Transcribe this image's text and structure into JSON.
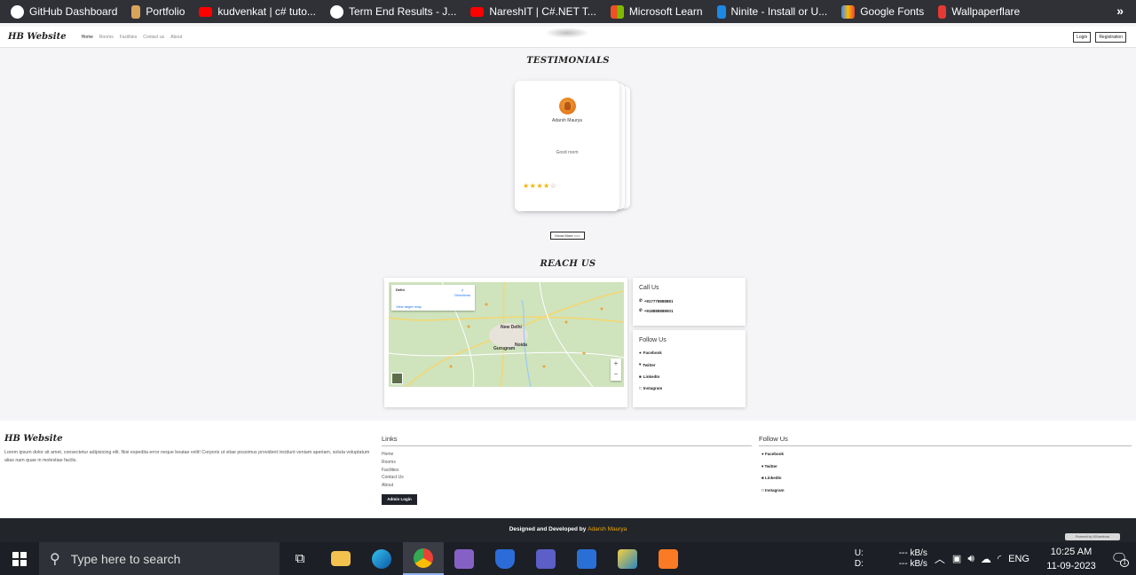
{
  "bookmarks": {
    "items": [
      {
        "label": "GitHub Dashboard",
        "icon": "github-icon",
        "color": "#ffffff"
      },
      {
        "label": "Portfolio",
        "icon": "person-icon",
        "color": "#d9a45a"
      },
      {
        "label": "kudvenkat | c# tuto...",
        "icon": "youtube-icon",
        "color": "#ff0000"
      },
      {
        "label": "Term End Results - J...",
        "icon": "globe-icon",
        "color": "#ffffff"
      },
      {
        "label": "NareshIT | C#.NET T...",
        "icon": "youtube-icon",
        "color": "#ff0000"
      },
      {
        "label": "Microsoft Learn",
        "icon": "microsoft-icon",
        "color": "#f25022"
      },
      {
        "label": "Ninite - Install or U...",
        "icon": "ninite-icon",
        "color": "#1e88e5"
      },
      {
        "label": "Google Fonts",
        "icon": "google-fonts-icon",
        "color": "#4285f4"
      },
      {
        "label": "Wallpaperflare",
        "icon": "wallpaperflare-icon",
        "color": "#e53935"
      }
    ],
    "more": "»"
  },
  "navbar": {
    "brand": "HB Website",
    "links": [
      "Home",
      "Rooms",
      "Facilities",
      "Contact us",
      "About"
    ],
    "login": "Login",
    "register": "Registration"
  },
  "testimonials": {
    "title": "TESTIMONIALS",
    "name": "Adarsh Maurya",
    "review": "Good room",
    "rating": 4,
    "stars_filled": "★★★★",
    "stars_empty": "☆",
    "know_more": "Know More >>>"
  },
  "reach_us": {
    "title": "REACH US",
    "map": {
      "place": "Delhi",
      "larger_map": "View larger map",
      "directions": "Directions",
      "zoom_in": "+",
      "zoom_out": "−",
      "cities": [
        "New Delhi",
        "Gurugram",
        "Noida"
      ]
    },
    "call_us": {
      "title": "Call Us",
      "phones": [
        "+917778888881",
        "+918888888001"
      ]
    },
    "follow_us": {
      "title": "Follow Us",
      "links": [
        "Facebook",
        "Twitter",
        "LinkedIn",
        "Instagram"
      ]
    }
  },
  "footer": {
    "brand": "HB Website",
    "description": "Lorem ipsum dolor sit amet, consectetur adipisicing elit. Nisi expedita error neque beatae velit! Corporis ut vitae possimus provident incidunt veniam aperiam, soluta voluptatum alias nam quae in molestiae facilis.",
    "links_title": "Links",
    "links": [
      "Home",
      "Rooms",
      "Facilities",
      "Contact Us",
      "About"
    ],
    "admin_login": "Admin Login",
    "follow_title": "Follow Us",
    "follow": [
      "Facebook",
      "Twitter",
      "LinkedIn",
      "Instagram"
    ]
  },
  "bottom_bar": {
    "text": "Designed and Developed by",
    "developer": "Adarsh Maurya",
    "powered": "Powered by 000webhost"
  },
  "taskbar": {
    "search_placeholder": "Type here to search",
    "net_up": "U:",
    "net_down": "D:",
    "up_rate": "--- kB/s",
    "down_rate": "--- kB/s",
    "language": "ENG",
    "time": "10:25 AM",
    "date": "11-09-2023",
    "notifications": "1"
  }
}
